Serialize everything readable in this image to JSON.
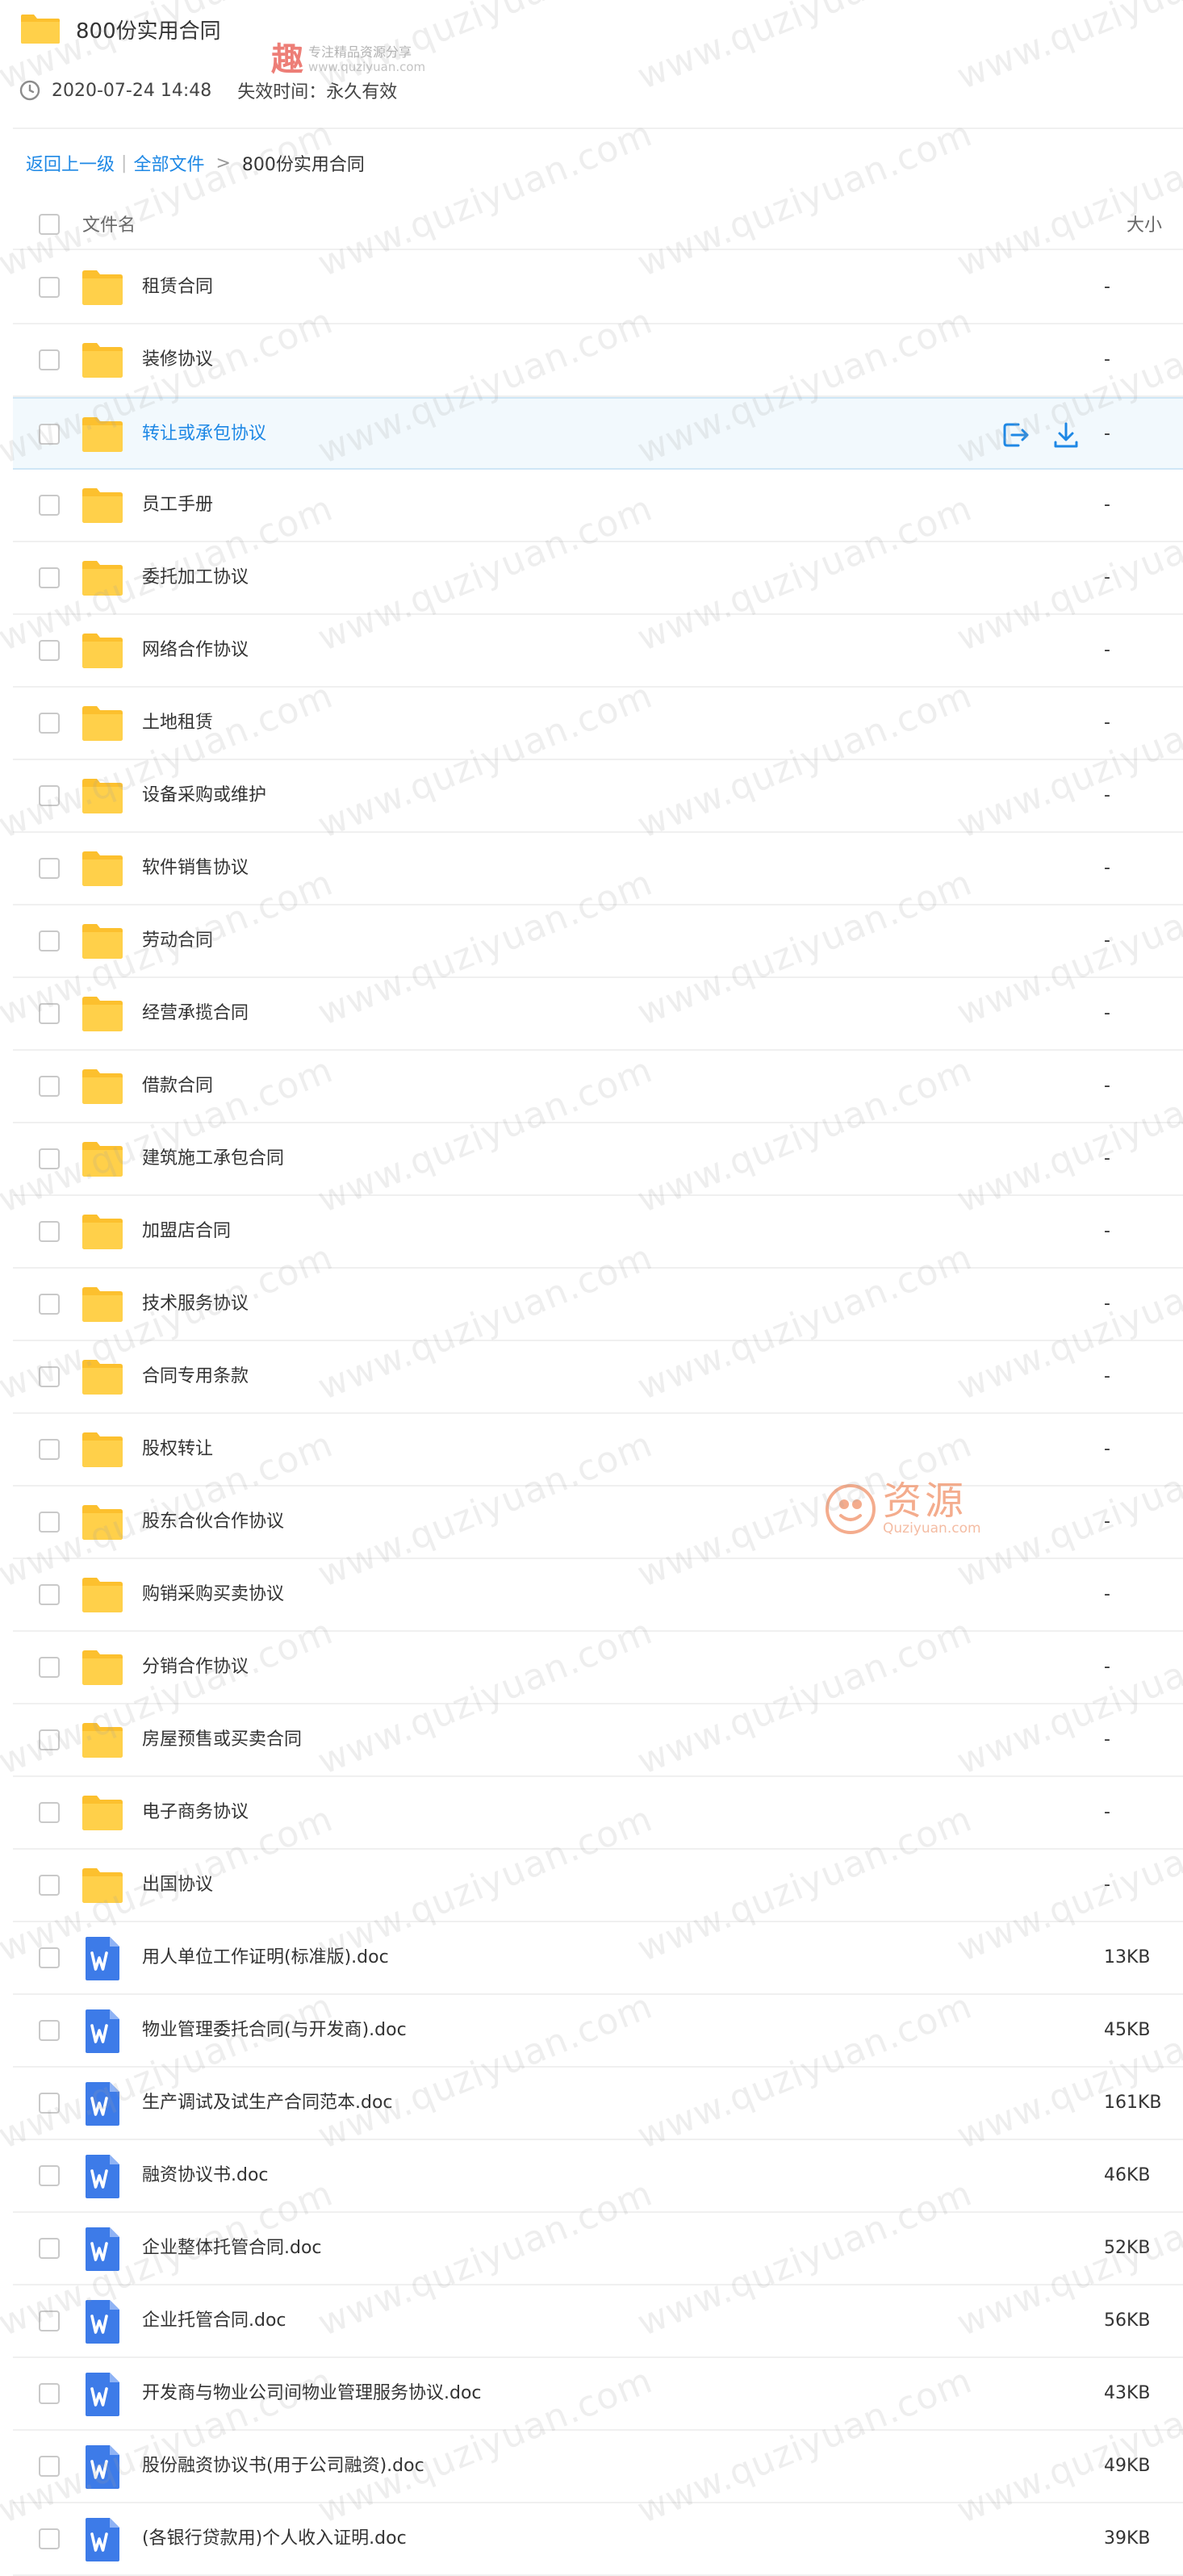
{
  "header": {
    "title": "800份实用合同",
    "timestamp": "2020-07-24 14:48",
    "expiry": "失效时间：永久有效"
  },
  "breadcrumb": {
    "back": "返回上一级",
    "separator": "|",
    "all_files": "全部文件",
    "arrow": ">",
    "current": "800份实用合同"
  },
  "table": {
    "col_name": "文件名",
    "col_size": "大小"
  },
  "files": [
    {
      "name": "租赁合同",
      "size": "-",
      "type": "folder"
    },
    {
      "name": "装修协议",
      "size": "-",
      "type": "folder"
    },
    {
      "name": "转让或承包协议",
      "size": "-",
      "type": "folder",
      "active": true
    },
    {
      "name": "员工手册",
      "size": "-",
      "type": "folder"
    },
    {
      "name": "委托加工协议",
      "size": "-",
      "type": "folder"
    },
    {
      "name": "网络合作协议",
      "size": "-",
      "type": "folder"
    },
    {
      "name": "土地租赁",
      "size": "-",
      "type": "folder"
    },
    {
      "name": "设备采购或维护",
      "size": "-",
      "type": "folder"
    },
    {
      "name": "软件销售协议",
      "size": "-",
      "type": "folder"
    },
    {
      "name": "劳动合同",
      "size": "-",
      "type": "folder"
    },
    {
      "name": "经营承揽合同",
      "size": "-",
      "type": "folder"
    },
    {
      "name": "借款合同",
      "size": "-",
      "type": "folder"
    },
    {
      "name": "建筑施工承包合同",
      "size": "-",
      "type": "folder"
    },
    {
      "name": "加盟店合同",
      "size": "-",
      "type": "folder"
    },
    {
      "name": "技术服务协议",
      "size": "-",
      "type": "folder"
    },
    {
      "name": "合同专用条款",
      "size": "-",
      "type": "folder"
    },
    {
      "name": "股权转让",
      "size": "-",
      "type": "folder"
    },
    {
      "name": "股东合伙合作协议",
      "size": "-",
      "type": "folder"
    },
    {
      "name": "购销采购买卖协议",
      "size": "-",
      "type": "folder"
    },
    {
      "name": "分销合作协议",
      "size": "-",
      "type": "folder"
    },
    {
      "name": "房屋预售或买卖合同",
      "size": "-",
      "type": "folder"
    },
    {
      "name": "电子商务协议",
      "size": "-",
      "type": "folder"
    },
    {
      "name": "出国协议",
      "size": "-",
      "type": "folder"
    },
    {
      "name": "用人单位工作证明(标准版).doc",
      "size": "13KB",
      "type": "doc"
    },
    {
      "name": "物业管理委托合同(与开发商).doc",
      "size": "45KB",
      "type": "doc"
    },
    {
      "name": "生产调试及试生产合同范本.doc",
      "size": "161KB",
      "type": "doc"
    },
    {
      "name": "融资协议书.doc",
      "size": "46KB",
      "type": "doc"
    },
    {
      "name": "企业整体托管合同.doc",
      "size": "52KB",
      "type": "doc"
    },
    {
      "name": "企业托管合同.doc",
      "size": "56KB",
      "type": "doc"
    },
    {
      "name": "开发商与物业公司间物业管理服务协议.doc",
      "size": "43KB",
      "type": "doc"
    },
    {
      "name": "股份融资协议书(用于公司融资).doc",
      "size": "49KB",
      "type": "doc"
    },
    {
      "name": "(各银行贷款用)个人收入证明.doc",
      "size": "39KB",
      "type": "doc"
    }
  ],
  "watermarks": {
    "text": "www.quziyuan.com",
    "logo_top_char": "趣",
    "logo_top_line1": "专注精品资源分享",
    "logo_top_line2": "www.quziyuan.com",
    "logo_mid_main": "资源",
    "logo_mid_sub": "Quziyuan.com"
  },
  "colors": {
    "link": "#1e88e5",
    "folder": "#fcc02e",
    "doc": "#3d7be8",
    "active_row": "#f2f9fd"
  },
  "icons": {
    "folder": "folder-icon",
    "doc": "word-doc-icon",
    "clock": "clock-icon",
    "save": "save-to-drive-icon",
    "download": "download-icon"
  }
}
